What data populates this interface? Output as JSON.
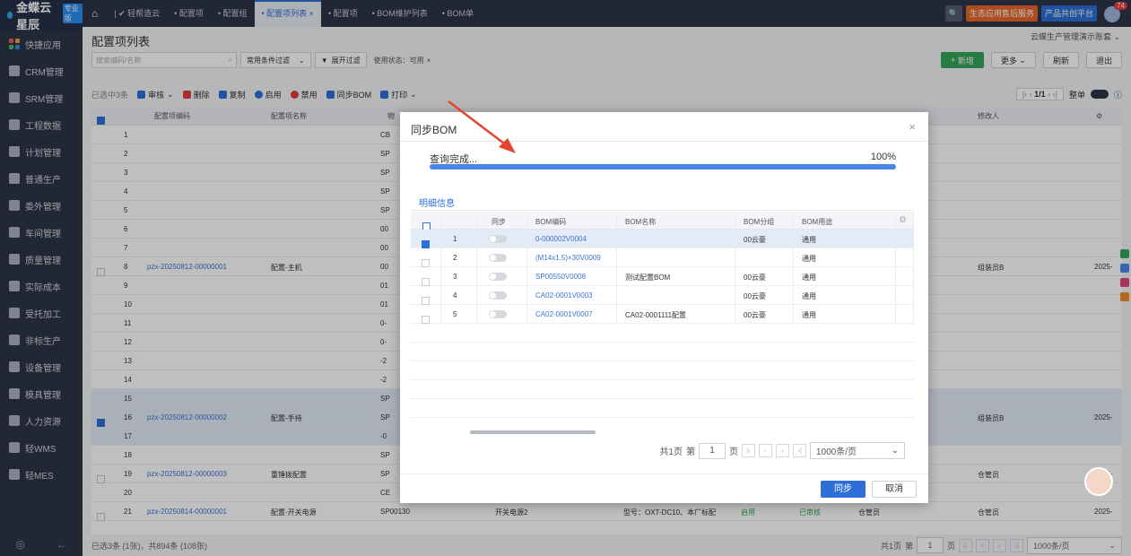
{
  "app": {
    "logo_text": "金蝶云星辰",
    "edition": "专业版"
  },
  "sidebar": {
    "items": [
      {
        "label": "快捷应用",
        "icon": "apps-icon"
      },
      {
        "label": "CRM管理",
        "icon": "crm-icon"
      },
      {
        "label": "SRM管理",
        "icon": "srm-icon"
      },
      {
        "label": "工程数据",
        "icon": "engineering-icon"
      },
      {
        "label": "计划管理",
        "icon": "plan-icon"
      },
      {
        "label": "普通生产",
        "icon": "production-icon"
      },
      {
        "label": "委外管理",
        "icon": "outsource-icon"
      },
      {
        "label": "车间管理",
        "icon": "workshop-icon"
      },
      {
        "label": "质量管理",
        "icon": "quality-icon"
      },
      {
        "label": "实际成本",
        "icon": "cost-icon"
      },
      {
        "label": "受托加工",
        "icon": "entrusted-icon"
      },
      {
        "label": "非标生产",
        "icon": "nonstandard-icon"
      },
      {
        "label": "设备管理",
        "icon": "equipment-icon"
      },
      {
        "label": "模具管理",
        "icon": "mold-icon"
      },
      {
        "label": "人力资源",
        "icon": "hr-icon"
      },
      {
        "label": "轻WMS",
        "icon": "wms-icon"
      },
      {
        "label": "轻MES",
        "icon": "mes-icon"
      }
    ],
    "bottom_left": "◎",
    "bottom_right": "←"
  },
  "tabs": [
    {
      "label": "轻帮造云"
    },
    {
      "label": "配置项"
    },
    {
      "label": "配置组"
    },
    {
      "label": "配置项列表",
      "active": true
    },
    {
      "label": "配置项"
    },
    {
      "label": "BOM维护列表"
    },
    {
      "label": "BOM单"
    }
  ],
  "top_right": {
    "eco_service": "生态应用售后服务",
    "product_platform": "产品共创平台",
    "notification_count": "74"
  },
  "page": {
    "title": "配置项列表",
    "org": "云蝶生产管理演示账套",
    "search_placeholder": "搜索编码/名称",
    "filter_select": "常用条件过滤",
    "expand_filter": "展开过滤",
    "status_chip": "使用状态：可用",
    "buttons": {
      "new": "新增",
      "more": "更多",
      "refresh": "刷新",
      "exit": "退出"
    }
  },
  "toolbar": {
    "selected": "已选中3条",
    "audit": "审核",
    "delete": "删除",
    "copy": "复制",
    "enable": "启用",
    "disable": "禁用",
    "sync_bom": "同步BOM",
    "print": "打印",
    "page_info": "1/1",
    "full_text": "整单"
  },
  "grid": {
    "columns": {
      "code": "配置项编码",
      "name": "配置项名称",
      "material": "物",
      "modifier": "修改人"
    },
    "rows": [
      {
        "no": "1",
        "mat": "CB"
      },
      {
        "no": "2",
        "mat": "SP"
      },
      {
        "no": "3",
        "mat": "SP"
      },
      {
        "no": "4",
        "mat": "SP"
      },
      {
        "no": "5",
        "mat": "SP"
      },
      {
        "no": "6",
        "mat": "00"
      },
      {
        "no": "7",
        "mat": "00"
      },
      {
        "no": "8",
        "mat": "00",
        "code": "pzx-20250812-00000001",
        "name": "配置-主机",
        "modifier": "组装员B",
        "date": "2025-"
      },
      {
        "no": "9",
        "mat": "01"
      },
      {
        "no": "10",
        "mat": "01"
      },
      {
        "no": "11",
        "mat": "0-"
      },
      {
        "no": "12",
        "mat": "0-"
      },
      {
        "no": "13",
        "mat": "-2"
      },
      {
        "no": "14",
        "mat": "-2"
      },
      {
        "no": "15",
        "mat": "SP"
      },
      {
        "no": "16",
        "mat": "SP",
        "code": "pzx-20250812-00000002",
        "name": "配置-手持",
        "modifier": "组装员B",
        "date": "2025-"
      },
      {
        "no": "17",
        "mat": "-0"
      },
      {
        "no": "18",
        "mat": "SP"
      },
      {
        "no": "19",
        "mat": "SP",
        "code": "pzx-20250812-00000003",
        "name": "重锤拨配置",
        "modifier": "仓管员",
        "date": "2025-"
      },
      {
        "no": "20",
        "mat": "CE"
      },
      {
        "no": "21",
        "mat": "SP00130",
        "code": "pzx-20250814-00000001",
        "name": "配置-开关电源",
        "extra1": "开关电源2",
        "extra2": "型号：OXT-DC10、本厂标配",
        "status1": "启用",
        "status2": "已审核",
        "role": "仓管员",
        "modifier": "仓管员",
        "date": "2025-"
      }
    ],
    "footer": "已选3条 (1张)，共894条 (108张)",
    "pager": {
      "total": "共1页",
      "page_label": "第",
      "page": "1",
      "page_unit": "页",
      "per_page": "1000条/页"
    }
  },
  "modal": {
    "title": "同步BOM",
    "close": "×",
    "progress_label": "查询完成...",
    "progress_pct": "100%",
    "progress_value": 1.0,
    "tab": "明细信息",
    "columns": {
      "sync": "同步",
      "code": "BOM编码",
      "name": "BOM名称",
      "group": "BOM分组",
      "use": "BOM用途"
    },
    "rows": [
      {
        "no": "1",
        "code": "0-000002V0004",
        "name": "",
        "group": "00云豪",
        "use": "通用",
        "checked": true
      },
      {
        "no": "2",
        "code": "(M14x1.5)×30V0009",
        "name": "",
        "group": "",
        "use": "通用",
        "checked": false
      },
      {
        "no": "3",
        "code": "SP00550V0008",
        "name": "测试配置BOM",
        "group": "00云豪",
        "use": "通用",
        "checked": false
      },
      {
        "no": "4",
        "code": "CA02-0001V0003",
        "name": "",
        "group": "00云豪",
        "use": "通用",
        "checked": false
      },
      {
        "no": "5",
        "code": "CA02-0001V0007",
        "name": "CA02-0001111配置",
        "group": "00云豪",
        "use": "通用",
        "checked": false
      }
    ],
    "pager": {
      "total": "共1页",
      "page_label": "第",
      "page": "1",
      "page_unit": "页",
      "per_page": "1000条/页"
    },
    "buttons": {
      "sync": "同步",
      "cancel": "取消"
    }
  }
}
